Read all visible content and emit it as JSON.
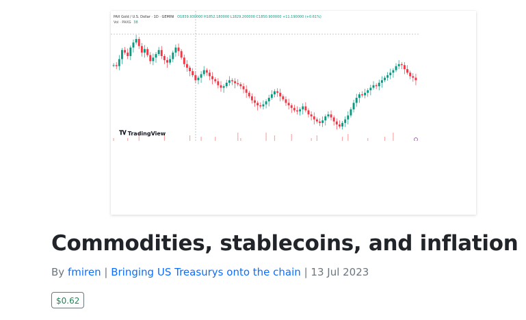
{
  "chart_image": {
    "header": {
      "symbol": "PAX Gold / U.S. Dollar · 1D · GEMINI",
      "ohlc": "O1839.930000 H1852.180000 L1829.200000 C1850.900000 +11.190000 (+0.61%)"
    },
    "volume_label": "Vol · PAXG",
    "volume_value": "38",
    "watermark": "TradingView",
    "colors": {
      "up": "#089981",
      "down": "#f23645",
      "volume_down": "#f7a9a7"
    },
    "chart_data": {
      "type": "candlestick",
      "description_source": "approximate visual trace of closes",
      "closes": [
        1960,
        1958,
        1972,
        1990,
        1985,
        1978,
        1995,
        2005,
        2012,
        1998,
        1985,
        1992,
        1980,
        1968,
        1975,
        1982,
        1990,
        1978,
        1970,
        1965,
        1972,
        1985,
        1995,
        1988,
        1975,
        1962,
        1955,
        1948,
        1940,
        1930,
        1935,
        1942,
        1950,
        1945,
        1938,
        1932,
        1928,
        1920,
        1915,
        1918,
        1925,
        1930,
        1928,
        1924,
        1922,
        1918,
        1912,
        1905,
        1898,
        1890,
        1885,
        1880,
        1878,
        1882,
        1888,
        1895,
        1902,
        1908,
        1905,
        1898,
        1892,
        1885,
        1880,
        1875,
        1870,
        1868,
        1872,
        1878,
        1870,
        1862,
        1858,
        1852,
        1848,
        1845,
        1850,
        1858,
        1862,
        1856,
        1848,
        1842,
        1838,
        1845,
        1852,
        1860,
        1872,
        1885,
        1895,
        1902,
        1900,
        1905,
        1910,
        1915,
        1920,
        1918,
        1925,
        1930,
        1935,
        1940,
        1945,
        1950,
        1958,
        1962,
        1960,
        1952,
        1945,
        1938,
        1935,
        1930
      ]
    }
  },
  "post": {
    "title": "Commodities, stablecoins, and inflation",
    "by_label": "By",
    "author": "fmiren",
    "separator": "|",
    "series": "Bringing US Treasurys onto the chain",
    "date": "13 Jul 2023",
    "price": "$0.62"
  }
}
